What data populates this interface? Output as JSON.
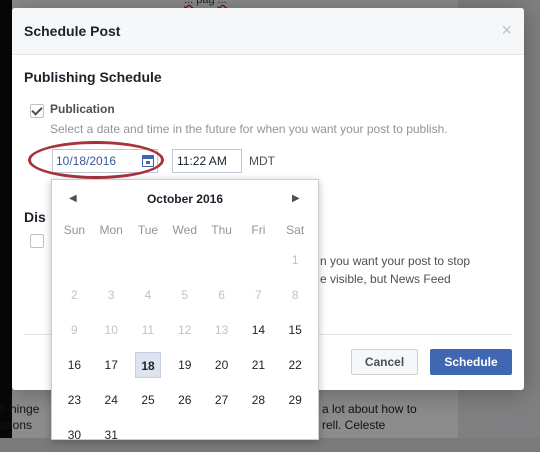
{
  "background": {
    "top_text_a": "...",
    "top_text_b": "pag",
    "top_text_c": "...",
    "lines_left": [
      "b hinge",
      "ations"
    ],
    "lines_right": [
      "a lot about how to",
      "rell. Celeste"
    ]
  },
  "dialog": {
    "title": "Schedule Post",
    "close_label": "×",
    "section_title": "Publishing Schedule",
    "publication": {
      "checked": true,
      "label": "Publication",
      "description": "Select a date and time in the future for when you want your post to publish.",
      "date_value": "10/18/2016",
      "time_value": "11:22 AM",
      "timezone": "MDT"
    },
    "distribution": {
      "title": "Dis",
      "desc_line1": "n you want your post to stop",
      "desc_line2": "e visible, but News Feed"
    },
    "buttons": {
      "cancel": "Cancel",
      "schedule": "Schedule"
    }
  },
  "calendar": {
    "month_label": "October 2016",
    "prev_label": "◀",
    "next_label": "▶",
    "weekdays": [
      "Sun",
      "Mon",
      "Tue",
      "Wed",
      "Thu",
      "Fri",
      "Sat"
    ],
    "weeks": [
      [
        "",
        "",
        "",
        "",
        "",
        "",
        "1"
      ],
      [
        "2",
        "3",
        "4",
        "5",
        "6",
        "7",
        "8"
      ],
      [
        "9",
        "10",
        "11",
        "12",
        "13",
        "14",
        "15"
      ],
      [
        "16",
        "17",
        "18",
        "19",
        "20",
        "21",
        "22"
      ],
      [
        "23",
        "24",
        "25",
        "26",
        "27",
        "28",
        "29"
      ],
      [
        "30",
        "31",
        "",
        "",
        "",
        "",
        ""
      ]
    ],
    "selected_day": "18",
    "first_enabled_day": "14"
  },
  "colors": {
    "accent": "#4267b2",
    "annotation_ellipse": "#a8323a"
  }
}
